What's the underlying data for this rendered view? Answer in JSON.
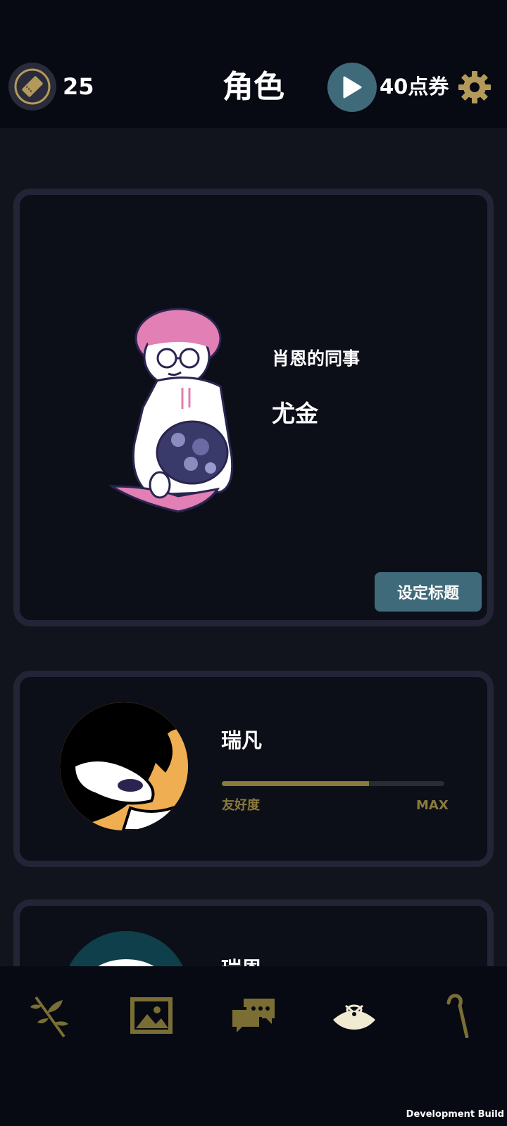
{
  "header": {
    "ticket_icon": "ticket-icon",
    "ticket_count": "25",
    "title": "角色",
    "play_icon": "play-icon",
    "voucher_label": "40点券",
    "settings_icon": "gear-icon"
  },
  "main_card": {
    "subtitle": "肖恩的同事",
    "name": "尤金",
    "set_title_button": "设定标题"
  },
  "characters": [
    {
      "name": "瑞凡",
      "affinity_label": "友好度",
      "affinity_max_label": "MAX",
      "affinity_fraction": 0.66
    },
    {
      "name": "瑞恩"
    }
  ],
  "bottom_nav": {
    "items": [
      {
        "icon": "branch-icon"
      },
      {
        "icon": "gallery-icon"
      },
      {
        "icon": "chat-icon"
      },
      {
        "icon": "character-icon",
        "active": true
      },
      {
        "icon": "cane-icon"
      }
    ]
  },
  "footer": {
    "dev_build": "Development Build"
  },
  "colors": {
    "accent_gold": "#8a7a3c",
    "accent_teal": "#3f6a7a",
    "background": "#12141d"
  }
}
